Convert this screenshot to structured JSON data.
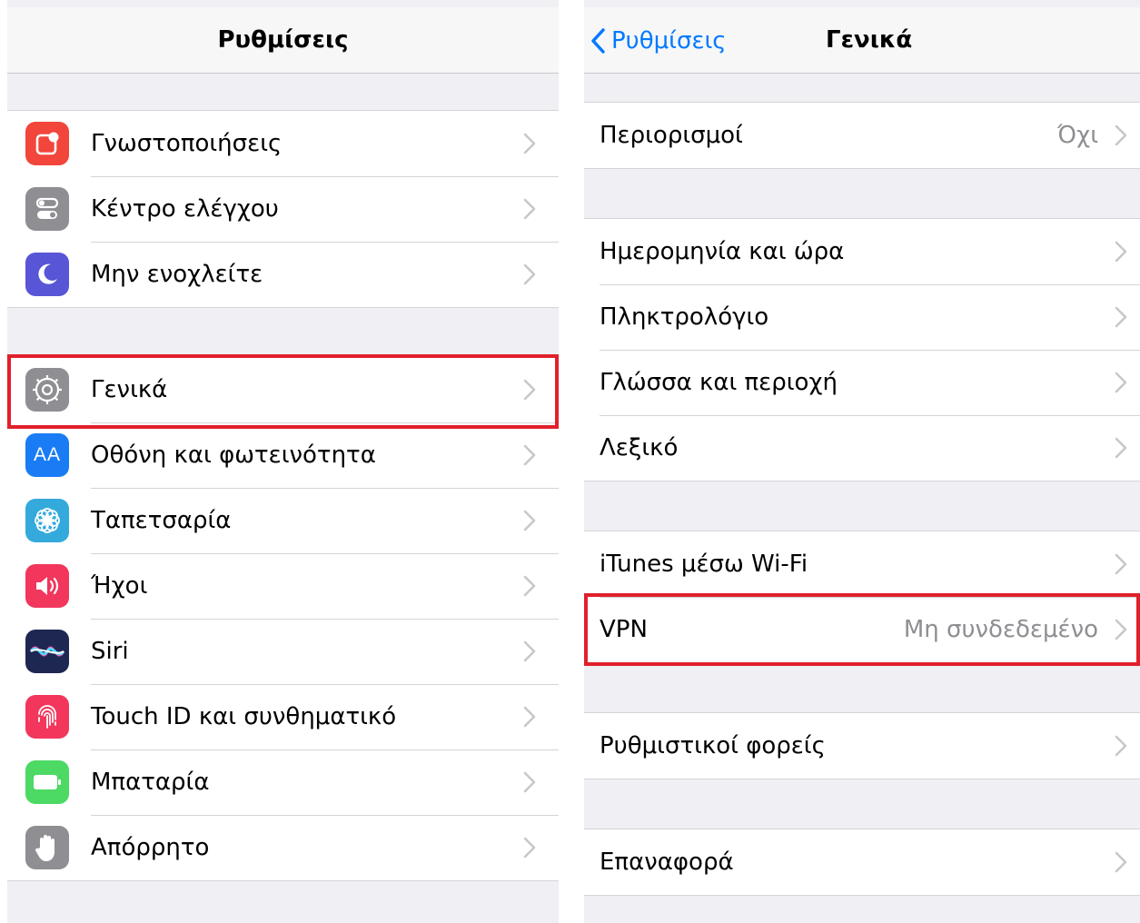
{
  "left_screen": {
    "title": "Ρυθμίσεις",
    "groups": [
      [
        {
          "label": "Γνωστοποιήσεις",
          "icon": "notifications-icon",
          "color": "#f2453c"
        },
        {
          "label": "Κέντρο ελέγχου",
          "icon": "control-center-icon",
          "color": "#8e8e93"
        },
        {
          "label": "Μην ενοχλείτε",
          "icon": "moon-icon",
          "color": "#5856d6"
        }
      ],
      [
        {
          "label": "Γενικά",
          "icon": "gear-icon",
          "color": "#8e8e93",
          "highlighted": true
        },
        {
          "label": "Οθόνη και φωτεινότητα",
          "icon": "display-brightness-icon",
          "icon_text": "AA",
          "color": "#1a7cf5"
        },
        {
          "label": "Ταπετσαρία",
          "icon": "wallpaper-flower-icon",
          "color": "#34aadc"
        },
        {
          "label": "Ήχοι",
          "icon": "speaker-icon",
          "color": "#f2365c"
        },
        {
          "label": "Siri",
          "icon": "siri-icon",
          "color": "#1e2752"
        },
        {
          "label": "Touch ID και συνθηματικό",
          "icon": "fingerprint-icon",
          "color": "#f2365c"
        },
        {
          "label": "Μπαταρία",
          "icon": "battery-icon",
          "color": "#4cd964"
        },
        {
          "label": "Απόρρητο",
          "icon": "hand-icon",
          "color": "#8e8e93"
        }
      ]
    ]
  },
  "right_screen": {
    "back_label": "Ρυθμίσεις",
    "title": "Γενικά",
    "groups": [
      [
        {
          "label": "Περιορισμοί",
          "value": "Όχι"
        }
      ],
      [
        {
          "label": "Ημερομηνία και ώρα"
        },
        {
          "label": "Πληκτρολόγιο"
        },
        {
          "label": "Γλώσσα και περιοχή"
        },
        {
          "label": "Λεξικό"
        }
      ],
      [
        {
          "label": "iTunes μέσω Wi-Fi"
        },
        {
          "label": "VPN",
          "value": "Μη συνδεδεμένο",
          "highlighted": true
        }
      ],
      [
        {
          "label": "Ρυθμιστικοί φορείς"
        }
      ],
      [
        {
          "label": "Επαναφορά"
        }
      ]
    ]
  },
  "colors": {
    "accent": "#007aff",
    "highlight_border": "#e0202c",
    "background": "#efeff4",
    "chevron": "#c7c7cc"
  }
}
